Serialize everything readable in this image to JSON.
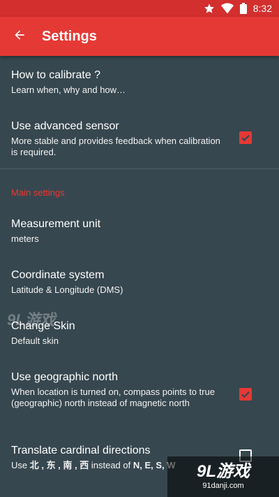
{
  "status_bar": {
    "time": "8:32",
    "icons": [
      "star-icon",
      "wifi-icon",
      "battery-icon"
    ]
  },
  "app_bar": {
    "title": "Settings",
    "back_icon": "arrow-left-icon"
  },
  "colors": {
    "accent": "#e53935",
    "status_bar": "#d32f2f",
    "background": "#37474f"
  },
  "preferences": [
    {
      "title": "How to calibrate ?",
      "summary": "Learn when, why and how…"
    },
    {
      "title": "Use advanced sensor",
      "summary": "More stable and provides feedback when calibration is required.",
      "checked": true
    }
  ],
  "main_settings": {
    "header": "Main settings",
    "items": [
      {
        "title": "Measurement unit",
        "summary": "meters"
      },
      {
        "title": "Coordinate system",
        "summary": "Latitude & Longitude (DMS)"
      },
      {
        "title": "Change Skin",
        "summary": "Default skin"
      },
      {
        "title": "Use geographic north",
        "summary": "When location is turned on, compass points to true (geographic) north instead of magnetic north",
        "checked": true
      },
      {
        "title": "Translate cardinal directions",
        "summary_prefix": "Use ",
        "summary_cjk": "北 , 东 , 南 , 西",
        "summary_mid": " instead of ",
        "summary_latin": "N, E, S, W",
        "checked": false
      }
    ]
  },
  "watermark": {
    "top": "9L游戏",
    "brand": "9L游戏",
    "url": "91danji.com"
  }
}
